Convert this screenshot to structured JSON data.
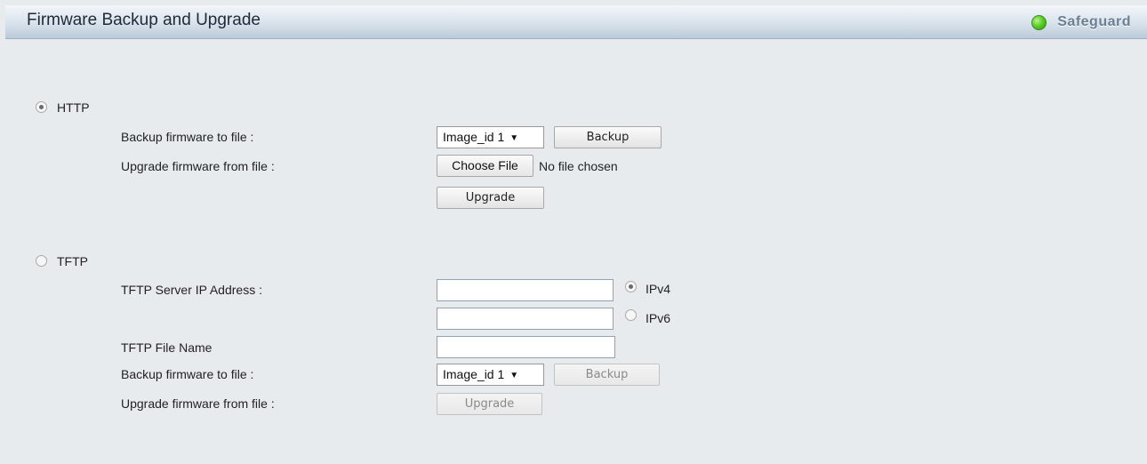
{
  "header": {
    "title": "Firmware Backup and Upgrade",
    "status_label": "Safeguard",
    "status_color": "#4cc221",
    "status_icon": "status-dot-icon"
  },
  "http": {
    "radio_label": "HTTP",
    "selected": true,
    "backup_label": "Backup firmware to file :",
    "backup_select_value": "Image_id 1",
    "backup_button": "Backup",
    "upgrade_label": "Upgrade firmware from file :",
    "choose_file_button": "Choose File",
    "no_file_text": "No file chosen",
    "upgrade_button": "Upgrade"
  },
  "tftp": {
    "radio_label": "TFTP",
    "selected": false,
    "server_ip_label": "TFTP Server IP Address :",
    "ipv4_label": "IPv4",
    "ipv4_selected": true,
    "ipv4_value": "",
    "ipv6_label": "IPv6",
    "ipv6_selected": false,
    "ipv6_value": "",
    "file_name_label": "TFTP File Name",
    "file_name_value": "",
    "backup_label": "Backup firmware to file :",
    "backup_select_value": "Image_id 1",
    "backup_button": "Backup",
    "upgrade_label": "Upgrade firmware from file :",
    "upgrade_button": "Upgrade"
  }
}
